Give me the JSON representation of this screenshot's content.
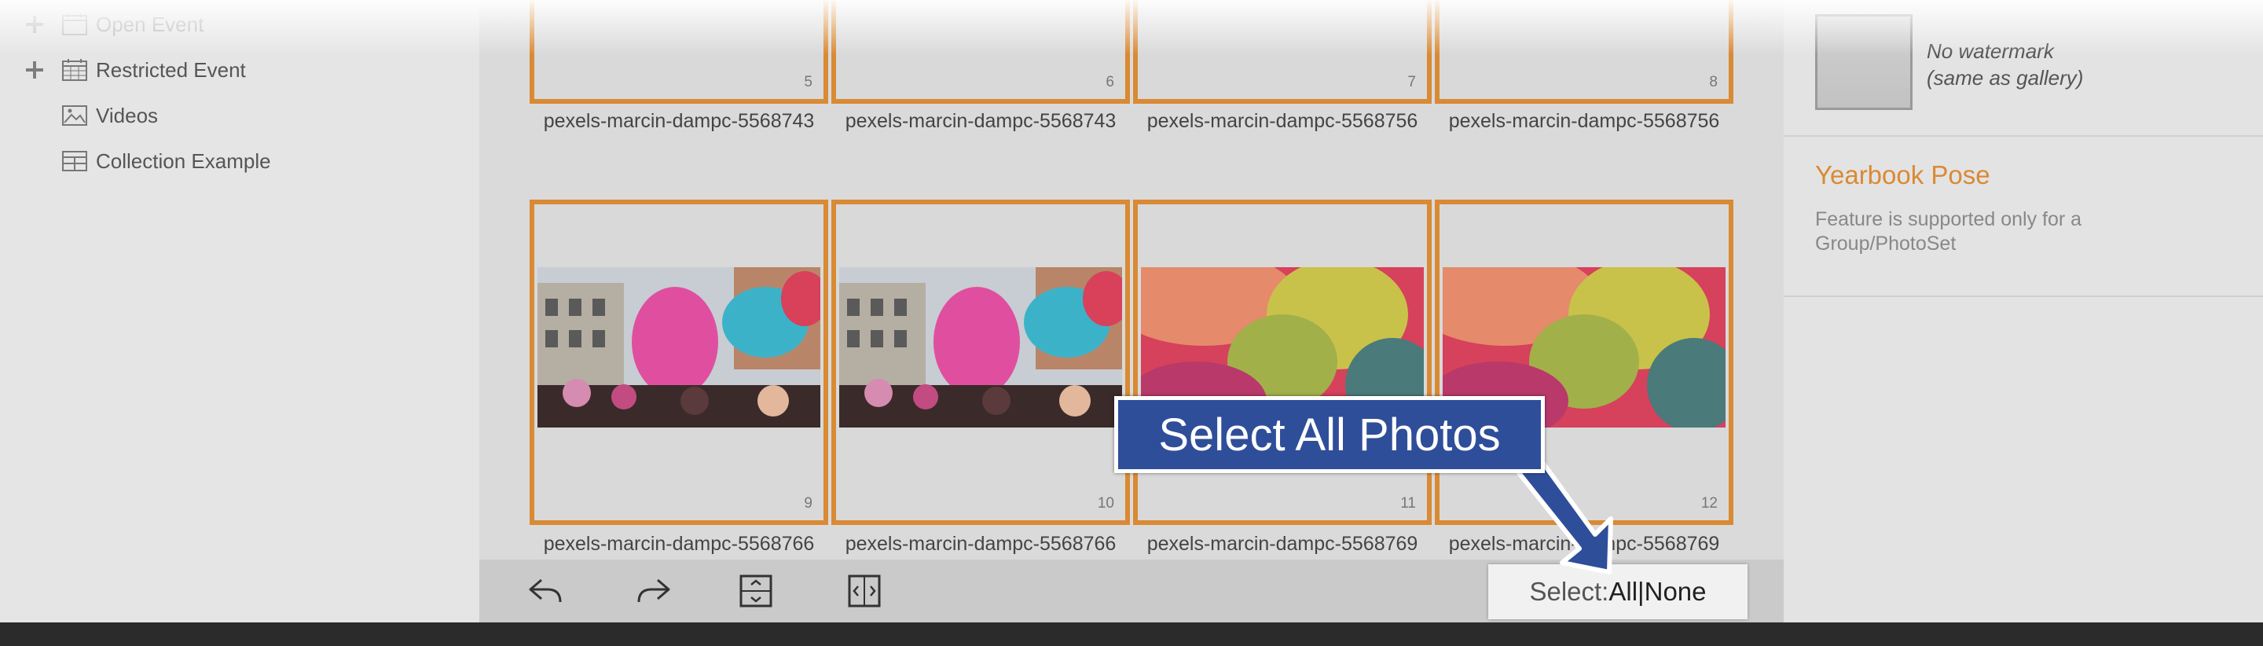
{
  "sidebar": {
    "items": [
      {
        "label": "Open Event",
        "icon": "calendar-icon",
        "expand": "plus-icon"
      },
      {
        "label": "Restricted Event",
        "icon": "calendar-icon",
        "expand": "plus-icon"
      },
      {
        "label": "Videos",
        "icon": "image-icon"
      },
      {
        "label": "Collection Example",
        "icon": "collection-icon"
      }
    ]
  },
  "gallery": {
    "top_row": [
      {
        "number": "5",
        "caption": "pexels-marcin-dampc-5568743"
      },
      {
        "number": "6",
        "caption": "pexels-marcin-dampc-5568743"
      },
      {
        "number": "7",
        "caption": "pexels-marcin-dampc-5568756"
      },
      {
        "number": "8",
        "caption": "pexels-marcin-dampc-5568756"
      }
    ],
    "bottom_row": [
      {
        "number": "9",
        "caption": "pexels-marcin-dampc-5568766"
      },
      {
        "number": "10",
        "caption": "pexels-marcin-dampc-5568766"
      },
      {
        "number": "11",
        "caption": "pexels-marcin-dampc-5568769"
      },
      {
        "number": "12",
        "caption": "pexels-marcin-dampc-5568769"
      }
    ]
  },
  "toolbar": {
    "buttons": [
      "undo-icon",
      "redo-icon",
      "fit-vertical-icon",
      "fit-horizontal-icon"
    ],
    "select_label": "Select: ",
    "select_all": "All",
    "separator": " | ",
    "select_none": "None"
  },
  "right_panel": {
    "watermark_line1": "No watermark",
    "watermark_line2": "(same as gallery)",
    "yearbook_title": "Yearbook Pose",
    "yearbook_text": "Feature is supported only for a Group/PhotoSet"
  },
  "callout": {
    "text": "Select All Photos"
  },
  "colors": {
    "accent_orange": "#d98a34",
    "callout_blue": "#2f4e9a",
    "footer_dark": "#2b2b2b"
  }
}
